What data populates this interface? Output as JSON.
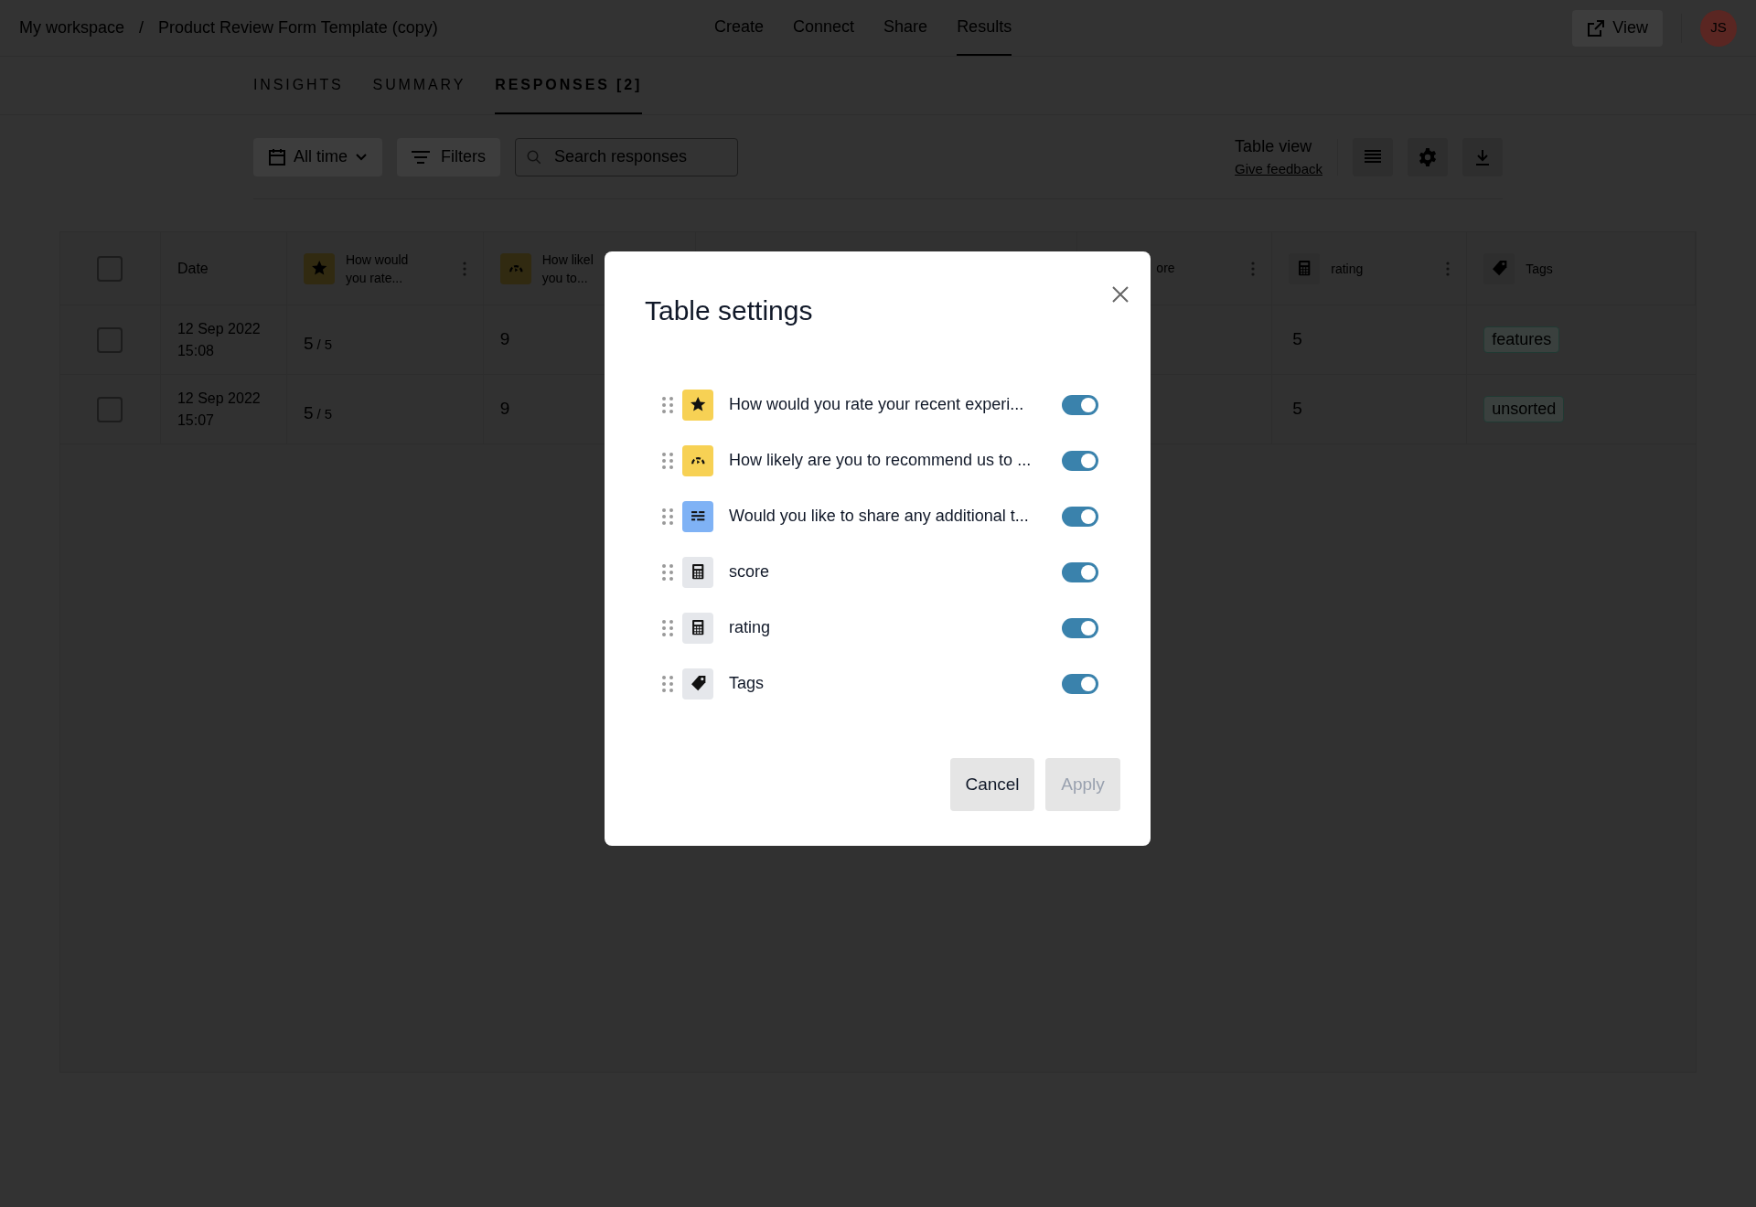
{
  "breadcrumb": {
    "workspace": "My workspace",
    "separator": "/",
    "form": "Product Review Form Template (copy)"
  },
  "nav": [
    {
      "label": "Create",
      "selected": false
    },
    {
      "label": "Connect",
      "selected": false
    },
    {
      "label": "Share",
      "selected": false
    },
    {
      "label": "Results",
      "selected": true
    }
  ],
  "view_button": "View",
  "avatar": "JS",
  "tabs": [
    {
      "label": "INSIGHTS",
      "selected": false
    },
    {
      "label": "SUMMARY",
      "selected": false
    },
    {
      "label": "RESPONSES [2]",
      "selected": true
    }
  ],
  "toolbar": {
    "date_filter": "All time",
    "filters": "Filters",
    "search": {
      "placeholder": "Search responses"
    },
    "view_title": "Table view",
    "feedback_link": "Give feedback"
  },
  "table": {
    "select_all_checked": false,
    "columns": [
      {
        "kind": "check"
      },
      {
        "kind": "date",
        "label": "Date"
      },
      {
        "kind": "star",
        "label": "How would you rate..."
      },
      {
        "kind": "gauge",
        "label": "How likel you to..."
      },
      {
        "kind": "hidden"
      },
      {
        "kind": "partial",
        "label": "ore"
      },
      {
        "kind": "calc",
        "label": "rating"
      },
      {
        "kind": "tag",
        "label": "Tags"
      }
    ],
    "rows": [
      {
        "checked": false,
        "date": "12 Sep 2022",
        "time": "15:08",
        "rating": "5",
        "rating_max": "/ 5",
        "likely": "9",
        "rating_score": "5",
        "tag": "features"
      },
      {
        "checked": false,
        "date": "12 Sep 2022",
        "time": "15:07",
        "rating": "5",
        "rating_max": "/ 5",
        "likely": "9",
        "rating_score": "5",
        "tag": "unsorted"
      }
    ]
  },
  "modal": {
    "title": "Table settings",
    "items": [
      {
        "kind": "star",
        "label": "How would you rate your recent experi...",
        "on": true
      },
      {
        "kind": "gauge",
        "label": "How likely are you to recommend us to ...",
        "on": true
      },
      {
        "kind": "text",
        "label": "Would you like to share any additional t...",
        "on": true
      },
      {
        "kind": "calc",
        "label": "score",
        "on": true
      },
      {
        "kind": "calc",
        "label": "rating",
        "on": true
      },
      {
        "kind": "tag",
        "label": "Tags",
        "on": true
      }
    ],
    "buttons": [
      {
        "label": "Cancel",
        "disabled": false
      },
      {
        "label": "Apply",
        "disabled": true
      }
    ]
  }
}
